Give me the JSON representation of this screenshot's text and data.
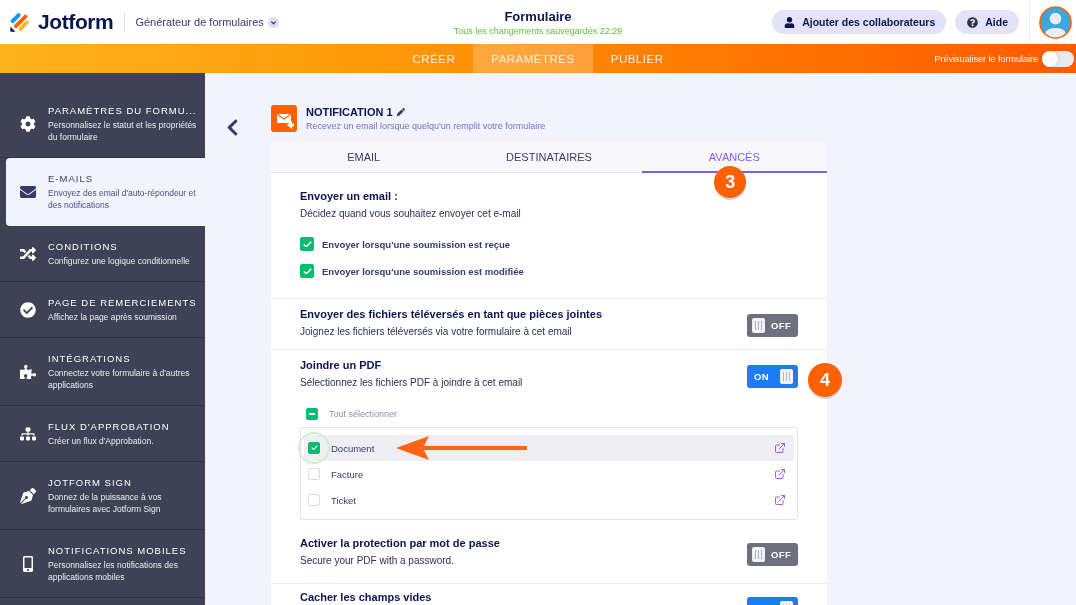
{
  "header": {
    "app_name": "Jotform",
    "builder_menu": "Générateur de formulaires",
    "form_title": "Formulaire",
    "save_status": "Tous les changements sauvegardés 22:29",
    "buttons": [
      {
        "kind": "invite",
        "label": "Ajouter des collaborateurs"
      },
      {
        "kind": "help",
        "label": "Aide"
      }
    ]
  },
  "nav_tabs": [
    {
      "label": "CRÉER",
      "selected": false
    },
    {
      "label": "PARAMÈTRES",
      "selected": true
    },
    {
      "label": "PUBLIER",
      "selected": false
    }
  ],
  "preview": {
    "label": "Prévisualiser le formulaire",
    "on": false
  },
  "sidebar": {
    "items": [
      {
        "title": "PARAMÈTRES DU FORMU...",
        "description": "Personnalisez le statut et les propriétés du formulaire",
        "selected": false
      },
      {
        "title": "E-MAILS",
        "description": "Envoyez des email d'auto-répondeur et des notifications",
        "selected": true
      },
      {
        "title": "CONDITIONS",
        "description": "Configurez une logique conditionnelle",
        "selected": false
      },
      {
        "title": "PAGE DE REMERCIEMENTS",
        "description": "Affichez la page après soumission",
        "selected": false
      },
      {
        "title": "INTÉGRATIONS",
        "description": "Connectez votre formulaire à d'autres applications",
        "selected": false
      },
      {
        "title": "FLUX D'APPROBATION",
        "description": "Créer un flux d'Approbation.",
        "selected": false
      },
      {
        "title": "JOTFORM SIGN",
        "description": "Donnez de la puissance à vos formulaires avec Jotform Sign",
        "selected": false
      },
      {
        "title": "NOTIFICATIONS MOBILES",
        "description": "Personnalisez les notifications des applications mobiles",
        "selected": false
      }
    ]
  },
  "notification": {
    "title": "NOTIFICATION 1",
    "subtitle": "Recevez un email lorsque quelqu'un remplit votre formulaire"
  },
  "tabs": [
    {
      "label": "EMAIL",
      "selected": false
    },
    {
      "label": "DESTINATAIRES",
      "selected": false
    },
    {
      "label": "AVANCÉS",
      "selected": true,
      "step": "3"
    }
  ],
  "sections": [
    {
      "kind": "checklist",
      "title": "Envoyer un email :",
      "description": "Décidez quand vous souhaitez envoyer cet e-mail",
      "options": [
        {
          "label": "Envoyer lorsqu'une soumission est reçue",
          "checked": true
        },
        {
          "label": "Envoyer lorsqu'une soumission est modifiée",
          "checked": true
        }
      ]
    },
    {
      "kind": "toggle",
      "title": "Envoyer des fichiers téléversés en tant que pièces jointes",
      "description": "Joignez les fichiers téléversés via votre formulaire à cet email",
      "toggle": {
        "on": false,
        "label": "OFF"
      }
    },
    {
      "kind": "pdf",
      "title": "Joindre un PDF",
      "description": "Sélectionnez les fichiers PDF à joindre à cet email",
      "toggle": {
        "on": true,
        "label": "ON"
      },
      "step": "4",
      "select_all": {
        "label": "Tout sélectionner",
        "indeterminate": true
      },
      "files": [
        {
          "name": "Document",
          "checked": true,
          "highlighted": true,
          "pointed": true,
          "circled": true
        },
        {
          "name": "Facture",
          "checked": false,
          "highlighted": false,
          "pointed": false,
          "circled": false
        },
        {
          "name": "Ticket",
          "checked": false,
          "highlighted": false,
          "pointed": false,
          "circled": false
        }
      ]
    },
    {
      "kind": "toggle",
      "title": "Activer la protection par mot de passe",
      "description": "Secure your PDF with a password.",
      "toggle": {
        "on": false,
        "label": "OFF"
      }
    },
    {
      "kind": "toggle",
      "title": "Cacher les champs vides",
      "toggle": {
        "on": true
      }
    }
  ]
}
